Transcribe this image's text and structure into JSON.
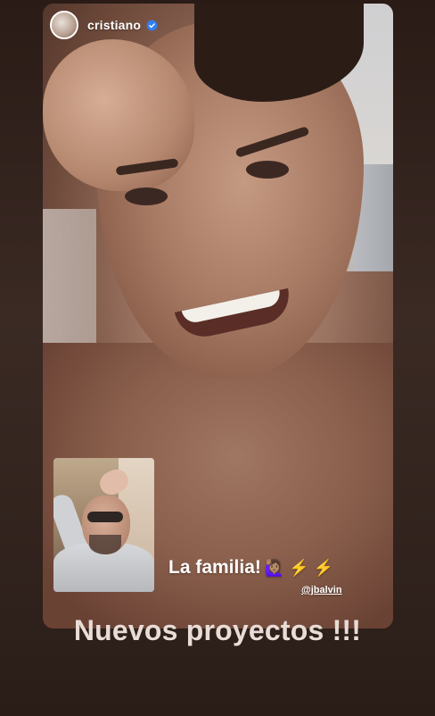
{
  "story": {
    "username": "cristiano",
    "verified": true,
    "caption": "La familia!",
    "caption_emojis": "🙋🏽‍♀️ ⚡ ⚡",
    "mention": "@jbalvin",
    "headline": "Nuevos proyectos !!!"
  },
  "icons": {
    "avatar": "avatar-icon",
    "verified": "verified-badge-icon"
  },
  "colors": {
    "verified_blue": "#2f7ff7",
    "text_primary": "#ffffff",
    "headline_text": "#e9dcd7"
  }
}
